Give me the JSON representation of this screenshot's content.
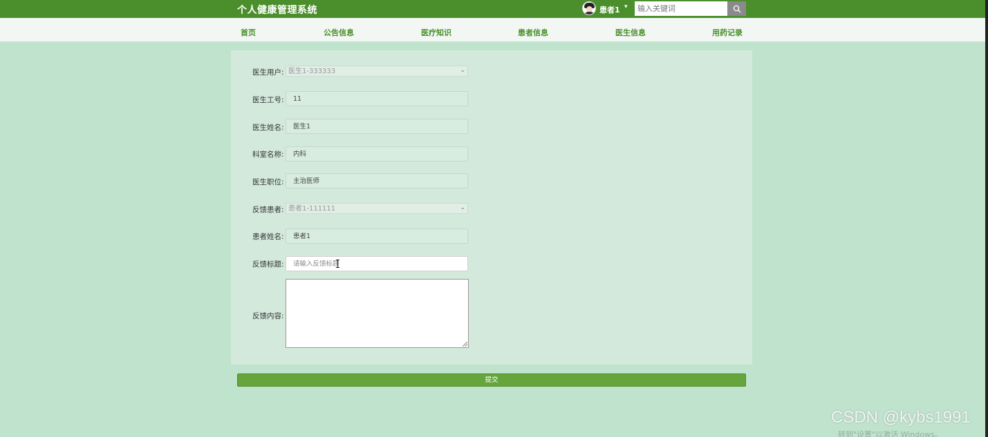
{
  "header": {
    "site_title": "个人健康管理系统",
    "user_name": "患者1",
    "user_caret": "▾",
    "search_placeholder": "输入关键词"
  },
  "nav": {
    "items": [
      "首页",
      "公告信息",
      "医疗知识",
      "患者信息",
      "医生信息",
      "用药记录"
    ]
  },
  "form": {
    "doctor_user": {
      "label": "医生用户:",
      "value": "医生1-333333"
    },
    "doctor_id": {
      "label": "医生工号:",
      "value": "11"
    },
    "doctor_name": {
      "label": "医生姓名:",
      "value": "医生1"
    },
    "department": {
      "label": "科室名称:",
      "value": "内科"
    },
    "position": {
      "label": "医生职位:",
      "value": "主治医师"
    },
    "feedback_patient": {
      "label": "反馈患者:",
      "value": "患者1-111111"
    },
    "patient_name": {
      "label": "患者姓名:",
      "value": "患者1"
    },
    "feedback_title": {
      "label": "反馈标题:",
      "placeholder": "请输入反馈标题"
    },
    "feedback_content": {
      "label": "反馈内容:",
      "value": ""
    },
    "submit_label": "提交"
  },
  "overlay": {
    "watermark": "CSDN @kybs1991",
    "windows_activate": "转到\"设置\"以激活 Windows。"
  },
  "colors": {
    "topbar": "#4a8f2b",
    "page_bg": "#bfe3cd",
    "panel_bg": "#d3e9dc",
    "submit": "#65a53c"
  }
}
